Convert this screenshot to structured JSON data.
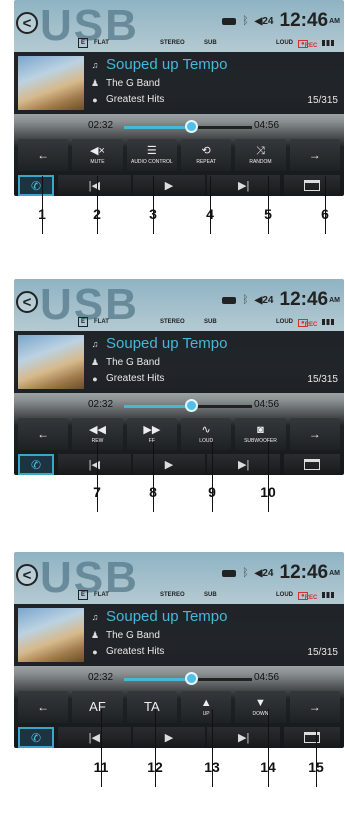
{
  "screen": {
    "source_title": "USB",
    "time": "12:46",
    "ampm": "AM",
    "volume": "24",
    "eq_flat": "FLAT",
    "stereo": "STEREO",
    "sub": "SUB",
    "loud": "LOUD",
    "rec": "REC",
    "track": {
      "title": "Souped up Tempo",
      "artist": "The G Band",
      "album": "Greatest Hits",
      "counter": "15/315"
    },
    "elapsed": "02:32",
    "total": "04:56",
    "progress_fraction": 0.52
  },
  "panels": [
    {
      "buttons": [
        {
          "name": "prev-page-button",
          "icon": "arrow-left-icon",
          "glyph": "←",
          "label": ""
        },
        {
          "name": "mute-button",
          "icon": "mute-icon",
          "glyph": "◀×",
          "label": "MUTE"
        },
        {
          "name": "audio-control-button",
          "icon": "sliders-icon",
          "glyph": "☰",
          "label": "AUDIO CONTROL"
        },
        {
          "name": "repeat-button",
          "icon": "repeat-icon",
          "glyph": "⟲",
          "label": "REPEAT"
        },
        {
          "name": "random-button",
          "icon": "shuffle-icon",
          "glyph": "⤨",
          "label": "RANDOM"
        },
        {
          "name": "next-page-button",
          "icon": "arrow-right-icon",
          "glyph": "→",
          "label": ""
        }
      ],
      "callouts": [
        "1",
        "2",
        "3",
        "4",
        "5",
        "6"
      ]
    },
    {
      "buttons": [
        {
          "name": "prev-page-button",
          "icon": "arrow-left-icon",
          "glyph": "←",
          "label": ""
        },
        {
          "name": "rew-button",
          "icon": "rewind-icon",
          "glyph": "◀◀",
          "label": "REW"
        },
        {
          "name": "ff-button",
          "icon": "fast-forward-icon",
          "glyph": "▶▶",
          "label": "FF"
        },
        {
          "name": "loud-button",
          "icon": "loud-curve-icon",
          "glyph": "∿",
          "label": "LOUD"
        },
        {
          "name": "subwoofer-button",
          "icon": "subwoofer-icon",
          "glyph": "◙",
          "label": "SUBWOOFER"
        },
        {
          "name": "next-page-button",
          "icon": "arrow-right-icon",
          "glyph": "→",
          "label": ""
        }
      ],
      "callouts": [
        "7",
        "8",
        "9",
        "10"
      ]
    },
    {
      "buttons": [
        {
          "name": "prev-page-button",
          "icon": "arrow-left-icon",
          "glyph": "←",
          "label": ""
        },
        {
          "name": "af-button",
          "icon": "",
          "glyph": "AF",
          "label": ""
        },
        {
          "name": "ta-button",
          "icon": "",
          "glyph": "TA",
          "label": ""
        },
        {
          "name": "up-button",
          "icon": "triangle-up-icon",
          "glyph": "▲",
          "label": "UP"
        },
        {
          "name": "down-button",
          "icon": "triangle-down-icon",
          "glyph": "▼",
          "label": "DOWN"
        },
        {
          "name": "next-page-button",
          "icon": "arrow-right-icon",
          "glyph": "→",
          "label": ""
        }
      ],
      "callouts": [
        "11",
        "12",
        "13",
        "14",
        "15"
      ]
    }
  ],
  "controls": {
    "phone_icon": "phone-icon",
    "prev_glyph": "|◀",
    "play_glyph": "▶",
    "next_glyph": "▶|",
    "folder_icon": "folder-icon"
  },
  "colors": {
    "accent": "#47b7d8",
    "rec": "#cc3333"
  }
}
